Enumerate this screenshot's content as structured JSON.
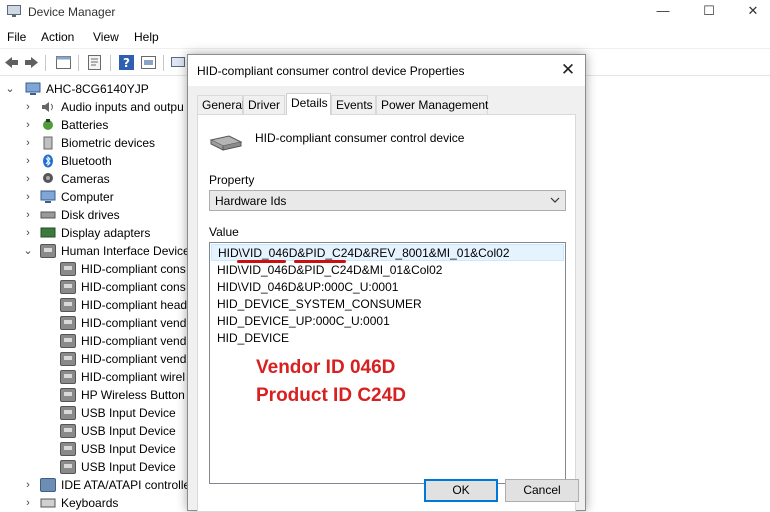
{
  "device_manager": {
    "title": "Device Manager",
    "controls": {
      "minimize": "—",
      "maximize": "☐",
      "close": "✕"
    },
    "menu": [
      "File",
      "Action",
      "View",
      "Help"
    ],
    "tree": {
      "root": "AHC-8CG6140YJP",
      "categories": [
        {
          "label": "Audio inputs and outpu",
          "icon": "speaker-icon"
        },
        {
          "label": "Batteries",
          "icon": "battery-icon"
        },
        {
          "label": "Biometric devices",
          "icon": "fingerprint-icon"
        },
        {
          "label": "Bluetooth",
          "icon": "bluetooth-icon"
        },
        {
          "label": "Cameras",
          "icon": "camera-icon"
        },
        {
          "label": "Computer",
          "icon": "computer-icon"
        },
        {
          "label": "Disk drives",
          "icon": "disk-drive-icon"
        },
        {
          "label": "Display adapters",
          "icon": "display-adapter-icon"
        },
        {
          "label": "Human Interface Device",
          "icon": "hid-icon"
        }
      ],
      "hid_children": [
        "HID-compliant cons",
        "HID-compliant cons",
        "HID-compliant head",
        "HID-compliant vend",
        "HID-compliant vend",
        "HID-compliant vend",
        "HID-compliant wirel",
        "HP Wireless Button D",
        "USB Input Device",
        "USB Input Device",
        "USB Input Device",
        "USB Input Device"
      ],
      "after": [
        {
          "label": "IDE ATA/ATAPI controlle",
          "icon": "ide-controller-icon"
        },
        {
          "label": "Keyboards",
          "icon": "keyboard-icon"
        }
      ]
    }
  },
  "dialog": {
    "title": "HID-compliant consumer control device Properties",
    "close": "✕",
    "tabs": [
      "General",
      "Driver",
      "Details",
      "Events",
      "Power Management"
    ],
    "active_tab": "Details",
    "device_name": "HID-compliant consumer control device",
    "property_label": "Property",
    "property_value": "Hardware Ids",
    "value_label": "Value",
    "values": [
      "HID\\VID_046D&PID_C24D&REV_8001&MI_01&Col02",
      "HID\\VID_046D&PID_C24D&MI_01&Col02",
      "HID\\VID_046D&UP:000C_U:0001",
      "HID_DEVICE_SYSTEM_CONSUMER",
      "HID_DEVICE_UP:000C_U:0001",
      "HID_DEVICE"
    ],
    "annotation": [
      "Vendor ID 046D",
      "Product ID C24D"
    ],
    "ok": "OK",
    "cancel": "Cancel"
  },
  "colors": {
    "annotation_red": "#d82020",
    "selected_row": "#e5f3ff",
    "default_button_border": "#0078d7"
  }
}
